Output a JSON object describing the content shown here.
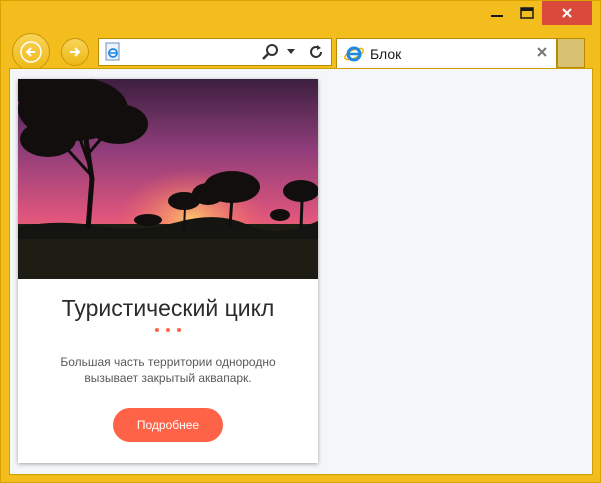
{
  "window": {
    "frame_color": "#f3be1d",
    "controls": {
      "minimize_icon": "minimize-icon",
      "maximize_icon": "maximize-icon",
      "close_icon": "close-icon"
    }
  },
  "browser": {
    "address": {
      "value": "",
      "page_icon": "ie-page-icon"
    },
    "tab": {
      "title": "Блок",
      "icon": "ie-logo-icon"
    }
  },
  "card": {
    "image_icon": "savanna-sunset-photo",
    "title": "Туристический цикл",
    "text": "Большая часть территории однородно вызывает закрытый аквапарк.",
    "button_label": "Подробнее",
    "accent_color": "#ff6347"
  }
}
